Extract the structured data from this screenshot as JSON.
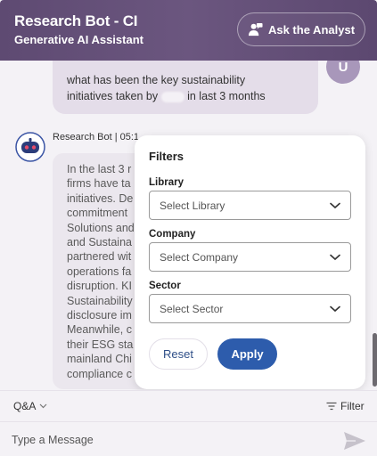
{
  "header": {
    "title": "Research Bot - CI",
    "subtitle": "Generative AI Assistant",
    "analyst_button": "Ask the Analyst"
  },
  "chat": {
    "user_message_line1": "what has been the key sustainability",
    "user_message_line2_pre": "initiatives taken by",
    "user_message_line2_post": "in last 3 months",
    "user_initial": "U",
    "bot_meta": "Research Bot | 05:1",
    "bot_lines": [
      "In the last 3 r",
      "firms have ta",
      "initiatives. De",
      "commitment",
      "Solutions and",
      "and Sustaina",
      "partnered wit",
      "operations fa",
      "disruption. KI",
      "Sustainability",
      "disclosure im",
      "Meanwhile, c",
      "their ESG sta",
      "mainland Chi",
      "compliance c"
    ]
  },
  "filters": {
    "title": "Filters",
    "library_label": "Library",
    "library_placeholder": "Select Library",
    "company_label": "Company",
    "company_placeholder": "Select Company",
    "sector_label": "Sector",
    "sector_placeholder": "Select Sector",
    "reset": "Reset",
    "apply": "Apply"
  },
  "toolbar": {
    "qa_label": "Q&A",
    "filter_label": "Filter"
  },
  "composer": {
    "placeholder": "Type a Message"
  },
  "colors": {
    "header": "#5e4a72",
    "apply": "#2d5cac",
    "accent_text": "#2f4f88"
  }
}
